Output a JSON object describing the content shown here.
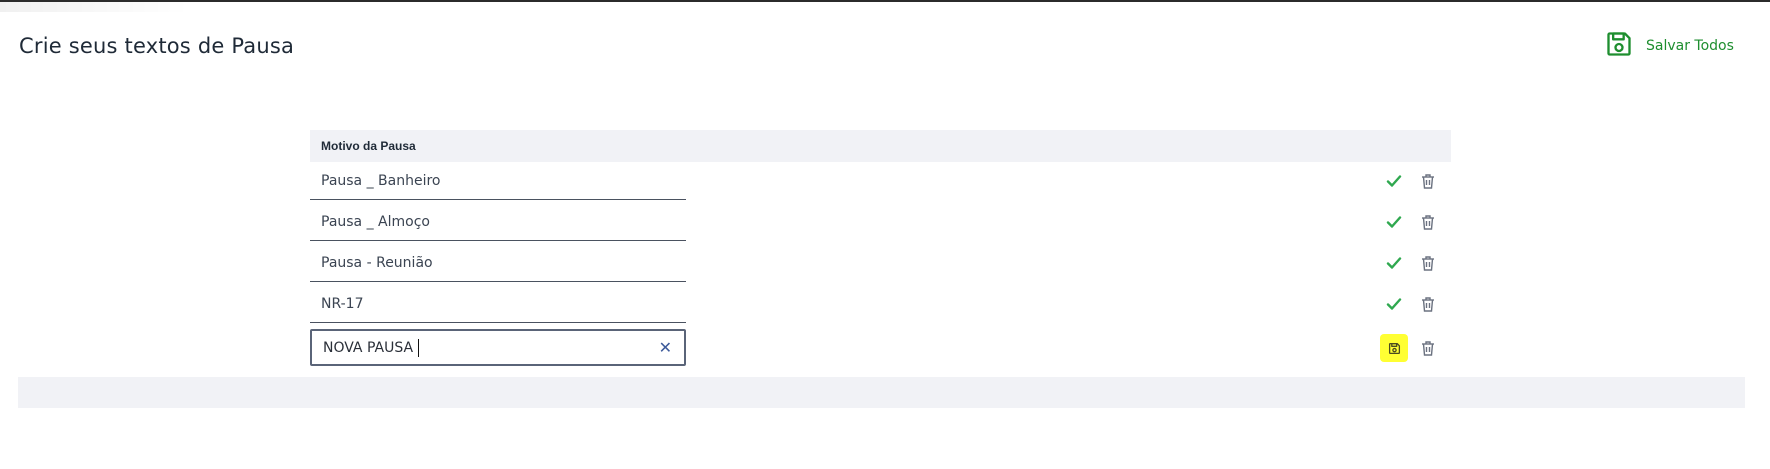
{
  "page": {
    "title": "Crie seus textos de Pausa"
  },
  "toolbar": {
    "save_all_label": "Salvar Todos",
    "save_all_icon": "floppy-disk-icon",
    "accent_color": "#1e8e2f"
  },
  "table": {
    "column_header": "Motivo da Pausa",
    "rows": [
      {
        "value": "Pausa _ Banheiro",
        "status_icon": "check-icon",
        "delete_icon": "trash-icon"
      },
      {
        "value": "Pausa _ Almoço",
        "status_icon": "check-icon",
        "delete_icon": "trash-icon"
      },
      {
        "value": "Pausa - Reunião",
        "status_icon": "check-icon",
        "delete_icon": "trash-icon"
      },
      {
        "value": "NR-17",
        "status_icon": "check-icon",
        "delete_icon": "trash-icon"
      }
    ],
    "new_row": {
      "value": "NOVA PAUSA",
      "clear_glyph": "✕",
      "save_icon": "floppy-disk-icon",
      "highlight_color": "#ffff33",
      "delete_icon": "trash-icon"
    }
  }
}
